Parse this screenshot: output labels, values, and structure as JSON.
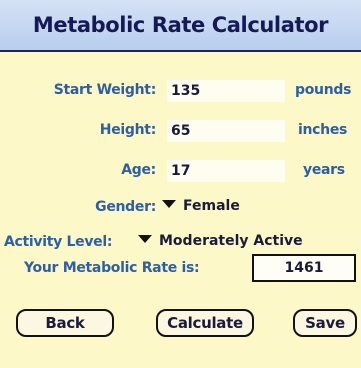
{
  "title": "Metabolic Rate Calculator",
  "fields": {
    "start_weight": {
      "label": "Start Weight:",
      "value": "135",
      "unit": "pounds"
    },
    "height": {
      "label": "Height:",
      "value": "65",
      "unit": "inches"
    },
    "age": {
      "label": "Age:",
      "value": "17",
      "unit": "years"
    },
    "gender": {
      "label": "Gender:",
      "value": "Female"
    },
    "activity": {
      "label": "Activity Level:",
      "value": "Moderately Active"
    }
  },
  "result": {
    "label": "Your Metabolic Rate is:",
    "value": "1461"
  },
  "buttons": {
    "back": "Back",
    "calculate": "Calculate",
    "save": "Save"
  },
  "colors": {
    "background": "#fdf8c8",
    "label_blue": "#2c5fa8",
    "title_bar": "#c8d8f2"
  }
}
